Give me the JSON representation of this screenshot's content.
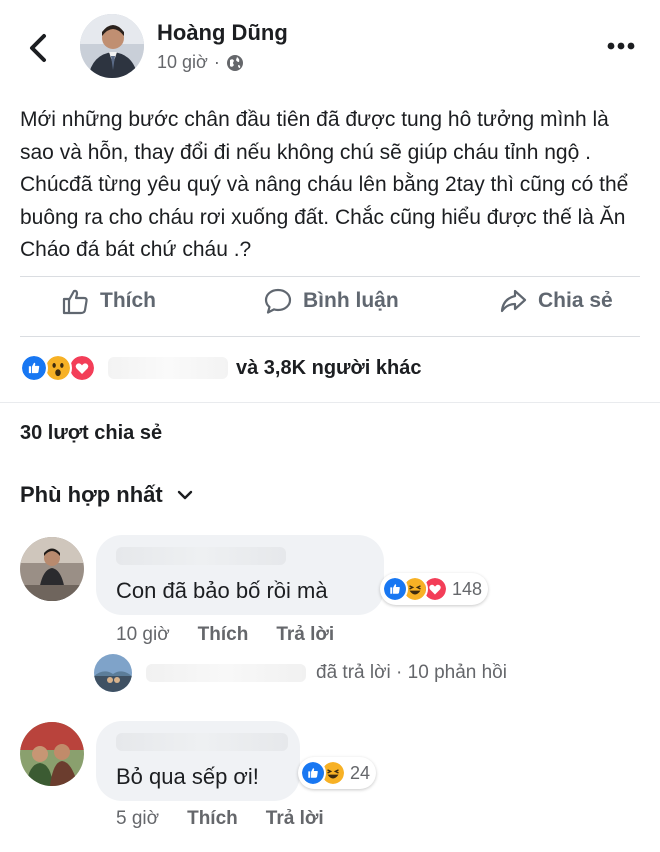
{
  "header": {
    "author_name": "Hoàng Dũng",
    "time": "10 giờ",
    "separator": "·",
    "back_icon": "chevron-left-icon",
    "privacy_icon": "globe-icon",
    "more_icon": "more-horizontal-icon"
  },
  "post": {
    "text": "Mới những bước chân đầu tiên đã được tung hô tưởng mình là sao và hỗn, thay đổi đi nếu không chú sẽ giúp cháu tỉnh ngộ . Chúcđã từng yêu quý và nâng cháu lên bằng 2tay thì cũng có thể buông ra cho cháu rơi xuống đất. Chắc cũng hiểu được thế là Ăn Cháo đá bát chứ cháu .?"
  },
  "actions": {
    "like_label": "Thích",
    "comment_label": "Bình luận",
    "share_label": "Chia sẻ"
  },
  "reactions": {
    "summary": "và 3,8K người khác",
    "icons": [
      "like-icon",
      "wow-icon",
      "love-icon"
    ]
  },
  "shares": {
    "label": "30 lượt chia sẻ"
  },
  "filter": {
    "label": "Phù hợp nhất"
  },
  "comments": [
    {
      "text": "Con đã bảo bố rồi mà",
      "reaction_count": "148",
      "reaction_icons": [
        "like-icon",
        "haha-icon",
        "love-icon"
      ],
      "time": "10 giờ",
      "like_label": "Thích",
      "reply_label": "Trả lời",
      "replies_text": "đã trả lời · 10 phản hồi"
    },
    {
      "text": "Bỏ qua sếp ơi!",
      "reaction_count": "24",
      "reaction_icons": [
        "like-icon",
        "haha-icon"
      ],
      "time": "5 giờ",
      "like_label": "Thích",
      "reply_label": "Trả lời"
    }
  ],
  "colors": {
    "text_primary": "#1c1e21",
    "text_secondary": "#65676b",
    "like_blue": "#1877f2",
    "love_red": "#f33e58",
    "emoji_yellow": "#f7b125",
    "bubble_bg": "#f0f2f5"
  }
}
